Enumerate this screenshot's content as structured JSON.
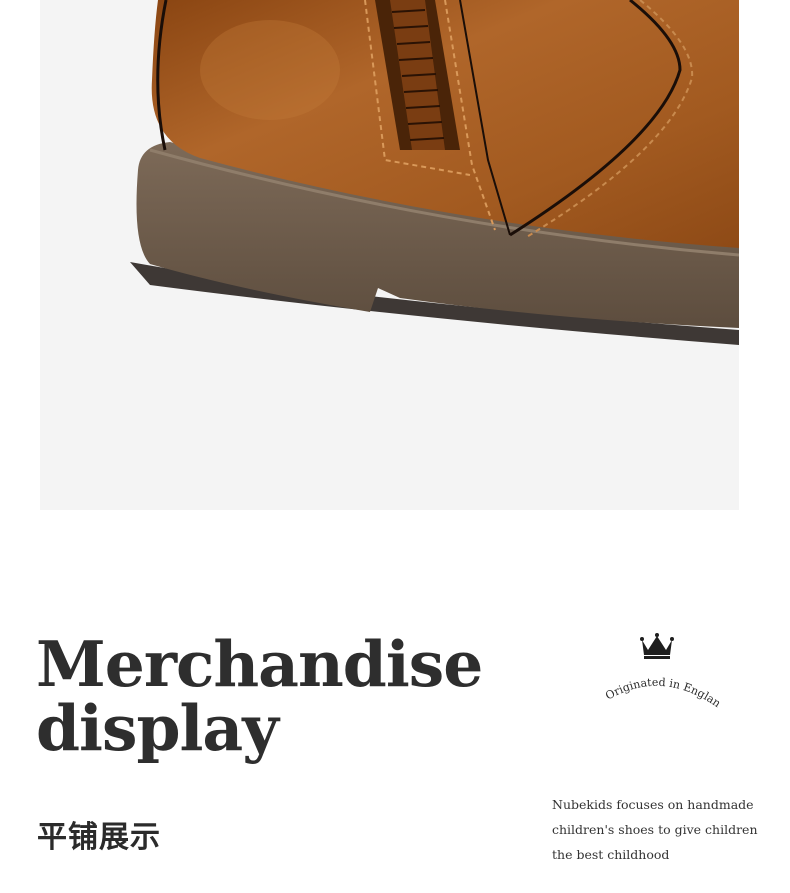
{
  "photo": {
    "subject": "brown-leather-zip-boot-closeup",
    "background_color": "#f4f4f4",
    "leather_color": "#a2591f",
    "sole_color": "#6b5a4a"
  },
  "heading": {
    "line1": "Merchandise",
    "line2": "display"
  },
  "subtitle_cn": "平铺展示",
  "badge": {
    "icon": "crown-icon",
    "arc_text": "Originated in England"
  },
  "description": {
    "line1": "Nubekids focuses on handmade",
    "line2": "children's shoes to give children",
    "line3": "the best childhood"
  }
}
